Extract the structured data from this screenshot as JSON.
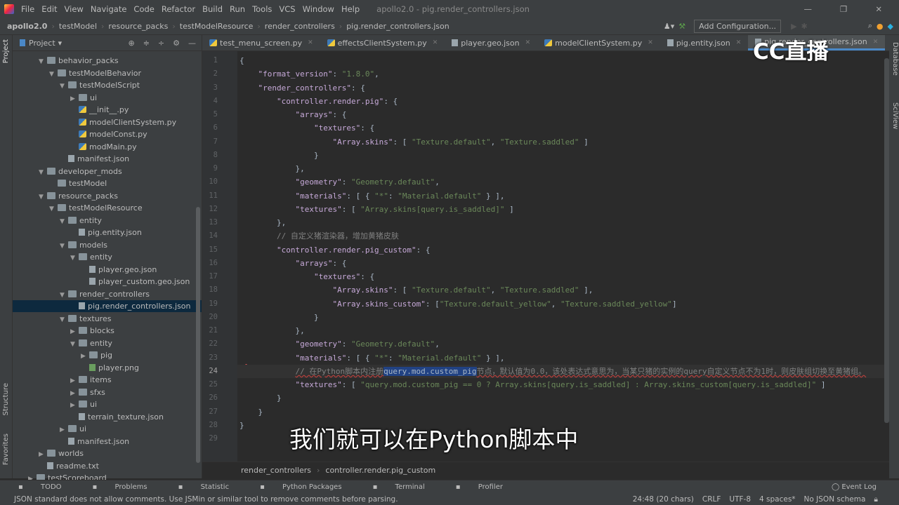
{
  "menu": [
    "File",
    "Edit",
    "View",
    "Navigate",
    "Code",
    "Refactor",
    "Build",
    "Run",
    "Tools",
    "VCS",
    "Window",
    "Help"
  ],
  "window_title": "apollo2.0 - pig.render_controllers.json",
  "breadcrumb": [
    "apollo2.0",
    "testModel",
    "resource_packs",
    "testModelResource",
    "render_controllers",
    "pig.render_controllers.json"
  ],
  "add_configuration": "Add Configuration...",
  "project_label": "Project",
  "left_strip": {
    "project": "Project",
    "structure": "Structure",
    "favorites": "Favorites"
  },
  "right_strip": {
    "database": "Database",
    "sciview": "SciView"
  },
  "tree": [
    {
      "label": "behavior_packs",
      "depth": 3,
      "type": "folder",
      "open": true
    },
    {
      "label": "testModelBehavior",
      "depth": 4,
      "type": "folder",
      "open": true
    },
    {
      "label": "testModelScript",
      "depth": 5,
      "type": "folder",
      "open": true
    },
    {
      "label": "ui",
      "depth": 6,
      "type": "folder",
      "open": false
    },
    {
      "label": "__init__.py",
      "depth": 6,
      "type": "py"
    },
    {
      "label": "modelClientSystem.py",
      "depth": 6,
      "type": "py"
    },
    {
      "label": "modelConst.py",
      "depth": 6,
      "type": "py"
    },
    {
      "label": "modMain.py",
      "depth": 6,
      "type": "py"
    },
    {
      "label": "manifest.json",
      "depth": 5,
      "type": "json"
    },
    {
      "label": "developer_mods",
      "depth": 3,
      "type": "folder",
      "open": true
    },
    {
      "label": "testModel",
      "depth": 4,
      "type": "folder",
      "open": false,
      "noarrow": true
    },
    {
      "label": "resource_packs",
      "depth": 3,
      "type": "folder",
      "open": true
    },
    {
      "label": "testModelResource",
      "depth": 4,
      "type": "folder",
      "open": true
    },
    {
      "label": "entity",
      "depth": 5,
      "type": "folder",
      "open": true
    },
    {
      "label": "pig.entity.json",
      "depth": 6,
      "type": "json"
    },
    {
      "label": "models",
      "depth": 5,
      "type": "folder",
      "open": true
    },
    {
      "label": "entity",
      "depth": 6,
      "type": "folder",
      "open": true
    },
    {
      "label": "player.geo.json",
      "depth": 7,
      "type": "json"
    },
    {
      "label": "player_custom.geo.json",
      "depth": 7,
      "type": "json"
    },
    {
      "label": "render_controllers",
      "depth": 5,
      "type": "folder",
      "open": true
    },
    {
      "label": "pig.render_controllers.json",
      "depth": 6,
      "type": "json",
      "selected": true
    },
    {
      "label": "textures",
      "depth": 5,
      "type": "folder",
      "open": true
    },
    {
      "label": "blocks",
      "depth": 6,
      "type": "folder",
      "open": false
    },
    {
      "label": "entity",
      "depth": 6,
      "type": "folder",
      "open": true
    },
    {
      "label": "pig",
      "depth": 7,
      "type": "folder",
      "open": false
    },
    {
      "label": "player.png",
      "depth": 7,
      "type": "png"
    },
    {
      "label": "items",
      "depth": 6,
      "type": "folder",
      "open": false
    },
    {
      "label": "sfxs",
      "depth": 6,
      "type": "folder",
      "open": false
    },
    {
      "label": "ui",
      "depth": 6,
      "type": "folder",
      "open": false
    },
    {
      "label": "terrain_texture.json",
      "depth": 6,
      "type": "json"
    },
    {
      "label": "ui",
      "depth": 5,
      "type": "folder",
      "open": false
    },
    {
      "label": "manifest.json",
      "depth": 5,
      "type": "json"
    },
    {
      "label": "worlds",
      "depth": 3,
      "type": "folder",
      "open": false
    },
    {
      "label": "readme.txt",
      "depth": 3,
      "type": "txt"
    },
    {
      "label": "testScoreboard",
      "depth": 2,
      "type": "folder",
      "open": false
    }
  ],
  "tabs": [
    {
      "label": "test_menu_screen.py",
      "type": "py"
    },
    {
      "label": "effectsClientSystem.py",
      "type": "py"
    },
    {
      "label": "player.geo.json",
      "type": "json"
    },
    {
      "label": "modelClientSystem.py",
      "type": "py"
    },
    {
      "label": "pig.entity.json",
      "type": "json"
    },
    {
      "label": "pig.render_controllers.json",
      "type": "json",
      "active": true
    }
  ],
  "code": [
    [
      [
        "p",
        "{"
      ]
    ],
    [
      [
        "p",
        "    "
      ],
      [
        "k",
        "\"format_version\""
      ],
      [
        "p",
        ": "
      ],
      [
        "s",
        "\"1.8.0\""
      ],
      [
        "p",
        ","
      ]
    ],
    [
      [
        "p",
        "    "
      ],
      [
        "k",
        "\"render_controllers\""
      ],
      [
        "p",
        ": {"
      ]
    ],
    [
      [
        "p",
        "        "
      ],
      [
        "k",
        "\"controller.render.pig\""
      ],
      [
        "p",
        ": {"
      ]
    ],
    [
      [
        "p",
        "            "
      ],
      [
        "k",
        "\"arrays\""
      ],
      [
        "p",
        ": {"
      ]
    ],
    [
      [
        "p",
        "                "
      ],
      [
        "k",
        "\"textures\""
      ],
      [
        "p",
        ": {"
      ]
    ],
    [
      [
        "p",
        "                    "
      ],
      [
        "k",
        "\"Array.skins\""
      ],
      [
        "p",
        ": [ "
      ],
      [
        "s",
        "\"Texture.default\""
      ],
      [
        "p",
        ", "
      ],
      [
        "s",
        "\"Texture.saddled\""
      ],
      [
        "p",
        " ]"
      ]
    ],
    [
      [
        "p",
        "                }"
      ]
    ],
    [
      [
        "p",
        "            },"
      ]
    ],
    [
      [
        "p",
        "            "
      ],
      [
        "k",
        "\"geometry\""
      ],
      [
        "p",
        ": "
      ],
      [
        "s",
        "\"Geometry.default\""
      ],
      [
        "p",
        ","
      ]
    ],
    [
      [
        "p",
        "            "
      ],
      [
        "k",
        "\"materials\""
      ],
      [
        "p",
        ": [ { "
      ],
      [
        "s",
        "\"*\""
      ],
      [
        "p",
        ": "
      ],
      [
        "s",
        "\"Material.default\""
      ],
      [
        "p",
        " } ],"
      ]
    ],
    [
      [
        "p",
        "            "
      ],
      [
        "k",
        "\"textures\""
      ],
      [
        "p",
        ": [ "
      ],
      [
        "s",
        "\"Array.skins[query.is_saddled]\""
      ],
      [
        "p",
        " ]"
      ]
    ],
    [
      [
        "p",
        "        },"
      ]
    ],
    [
      [
        "p",
        "        "
      ],
      [
        "c",
        "// 自定义猪渲染器，增加黄猪皮肤"
      ]
    ],
    [
      [
        "p",
        "        "
      ],
      [
        "k",
        "\"controller.render.pig_custom\""
      ],
      [
        "p",
        ": {"
      ]
    ],
    [
      [
        "p",
        "            "
      ],
      [
        "k",
        "\"arrays\""
      ],
      [
        "p",
        ": {"
      ]
    ],
    [
      [
        "p",
        "                "
      ],
      [
        "k",
        "\"textures\""
      ],
      [
        "p",
        ": {"
      ]
    ],
    [
      [
        "p",
        "                    "
      ],
      [
        "k",
        "\"Array.skins\""
      ],
      [
        "p",
        ": [ "
      ],
      [
        "s",
        "\"Texture.default\""
      ],
      [
        "p",
        ", "
      ],
      [
        "s",
        "\"Texture.saddled\""
      ],
      [
        "p",
        " ],"
      ]
    ],
    [
      [
        "p",
        "                    "
      ],
      [
        "k",
        "\"Array.skins_custom\""
      ],
      [
        "p",
        ": ["
      ],
      [
        "s",
        "\"Texture.default_yellow\""
      ],
      [
        "p",
        ", "
      ],
      [
        "s",
        "\"Texture.saddled_yellow\""
      ],
      [
        "p",
        "]"
      ]
    ],
    [
      [
        "p",
        "                }"
      ]
    ],
    [
      [
        "p",
        "            },"
      ]
    ],
    [
      [
        "p",
        "            "
      ],
      [
        "k",
        "\"geometry\""
      ],
      [
        "p",
        ": "
      ],
      [
        "s",
        "\"Geometry.default\""
      ],
      [
        "p",
        ","
      ]
    ],
    [
      [
        "p",
        "            "
      ],
      [
        "k",
        "\"materials\""
      ],
      [
        "p",
        ": [ { "
      ],
      [
        "s",
        "\"*\""
      ],
      [
        "p",
        ": "
      ],
      [
        "s",
        "\"Material.default\""
      ],
      [
        "p",
        " } ],"
      ]
    ],
    [
      [
        "p",
        "            "
      ],
      [
        "c",
        "// 在Python脚本内注册"
      ],
      [
        "h",
        "query.mod.custom_pig"
      ],
      [
        "c",
        "节点，默认值为0.0，该处表达式意思为，当某只猪的实例的query自定义节点不为1时，则皮肤组切换至黄猪组。"
      ]
    ],
    [
      [
        "p",
        "            "
      ],
      [
        "k",
        "\"textures\""
      ],
      [
        "p",
        ": [ "
      ],
      [
        "s",
        "\"query.mod.custom_pig == 0 ? Array.skins[query.is_saddled] : Array.skins_custom[query.is_saddled]\""
      ],
      [
        "p",
        " ]"
      ]
    ],
    [
      [
        "p",
        "        }"
      ]
    ],
    [
      [
        "p",
        "    }"
      ]
    ],
    [
      [
        "p",
        "}"
      ]
    ],
    [
      [
        "p",
        ""
      ]
    ]
  ],
  "current_line": 24,
  "editor_breadcrumb": [
    "render_controllers",
    "controller.render.pig_custom"
  ],
  "bottom_tools": [
    "TODO",
    "Problems",
    "Statistic",
    "Python Packages",
    "Terminal",
    "Profiler"
  ],
  "event_log": "Event Log",
  "status": {
    "message": "JSON standard does not allow comments. Use JSMin or similar tool to remove comments before parsing.",
    "position": "24:48 (20 chars)",
    "line_sep": "CRLF",
    "encoding": "UTF-8",
    "indent": "4 spaces*",
    "schema": "No JSON schema"
  },
  "subtitle": "我们就可以在Python脚本中",
  "watermark": "CC直播"
}
